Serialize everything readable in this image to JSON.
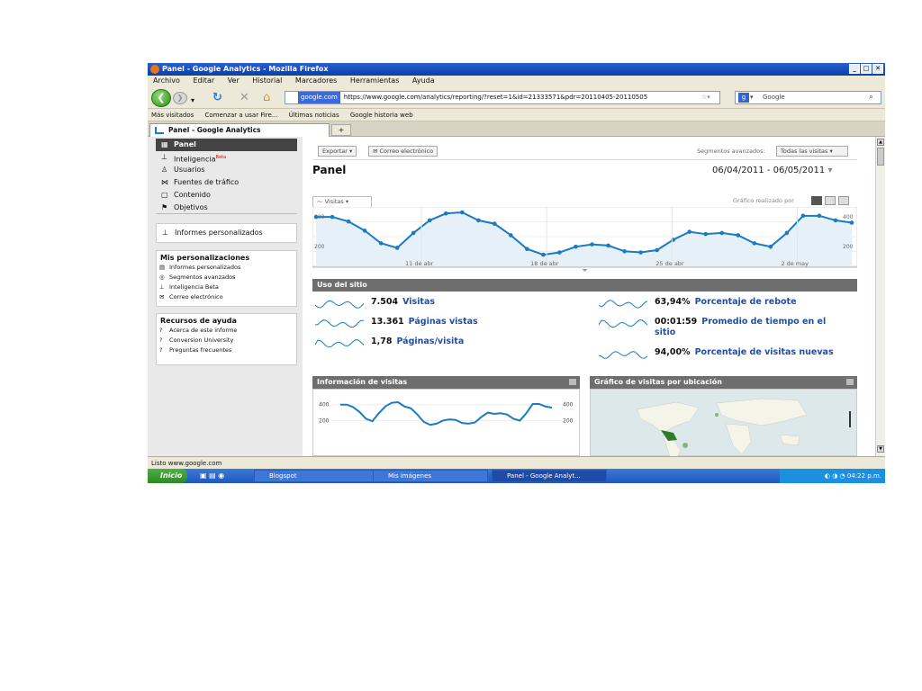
{
  "window": {
    "title": "Panel - Google Analytics - Mozilla Firefox"
  },
  "menu": [
    "Archivo",
    "Editar",
    "Ver",
    "Historial",
    "Marcadores",
    "Herramientas",
    "Ayuda"
  ],
  "nav": {
    "site": "google.com",
    "url": "https://www.google.com/analytics/reporting/?reset=1&id=21333571&pdr=20110405-20110505",
    "search_placeholder": "Google"
  },
  "bookmarks": [
    "Más visitados",
    "Comenzar a usar Fire...",
    "Últimas noticias",
    "Google historia web"
  ],
  "tab": {
    "label": "Panel - Google Analytics",
    "new_tab": "+"
  },
  "sidebar": {
    "nav": [
      "Panel",
      "Inteligencia",
      "Usuarios",
      "Fuentes de tráfico",
      "Contenido",
      "Objetivos"
    ],
    "beta_badge": "Beta",
    "custom_reports": "Informes personalizados",
    "personalizations_title": "Mis personalizaciones",
    "personalizations": [
      "Informes personalizados",
      "Segmentos avanzados",
      "Inteligencia Beta",
      "Correo electrónico"
    ],
    "help_title": "Recursos de ayuda",
    "help": [
      "Acerca de este informe",
      "Conversion University",
      "Preguntas frecuentes"
    ]
  },
  "toolbar": {
    "export": "Exportar",
    "email": "Correo electrónico",
    "segments_label": "Segmentos avanzados:",
    "segments_value": "Todas las visitas"
  },
  "panel": {
    "title": "Panel",
    "date_range": "06/04/2011 - 06/05/2011"
  },
  "chart_tab": {
    "label": "Visitas",
    "graph_by": "Gráfico realizado por"
  },
  "chart_data": {
    "type": "line",
    "title": "",
    "series": [
      {
        "name": "Visitas",
        "values": [
          400,
          400,
          380,
          340,
          285,
          265,
          330,
          385,
          415,
          420,
          385,
          370,
          320,
          260,
          235,
          245,
          270,
          280,
          275,
          250,
          245,
          255,
          300,
          335,
          325,
          330,
          320,
          285,
          270,
          330,
          405,
          405,
          385,
          375
        ]
      }
    ],
    "ylim": [
      0,
      400
    ],
    "yticks": [
      "400",
      "200"
    ],
    "xticks": [
      "11 de abr",
      "18 de abr",
      "25 de abr",
      "2 de may"
    ],
    "grid": true
  },
  "site_usage": {
    "title": "Uso del sitio",
    "left": [
      {
        "value": "7.504",
        "label": "Visitas"
      },
      {
        "value": "13.361",
        "label": "Páginas vistas"
      },
      {
        "value": "1,78",
        "label": "Páginas/visita"
      }
    ],
    "right": [
      {
        "value": "63,94%",
        "label": "Porcentaje de rebote"
      },
      {
        "value": "00:01:59",
        "label": "Promedio de tiempo en el sitio"
      },
      {
        "value": "94,00%",
        "label": "Porcentaje de visitas nuevas"
      }
    ]
  },
  "widgets": {
    "visits_title": "Información de visitas",
    "visits_ticks": [
      "400",
      "200"
    ],
    "map_title": "Gráfico de visitas por ubicación"
  },
  "statusbar": {
    "text": "Listo www.google.com"
  },
  "taskbar": {
    "start": "Inicio",
    "tasks": [
      "Blogspot",
      "Mis imágenes",
      "Panel - Google Analyt..."
    ],
    "clock": "04:22 p.m."
  },
  "colors": {
    "accent": "#1a7bc2",
    "section": "#6e6e6e",
    "link": "#1a4fb3"
  }
}
